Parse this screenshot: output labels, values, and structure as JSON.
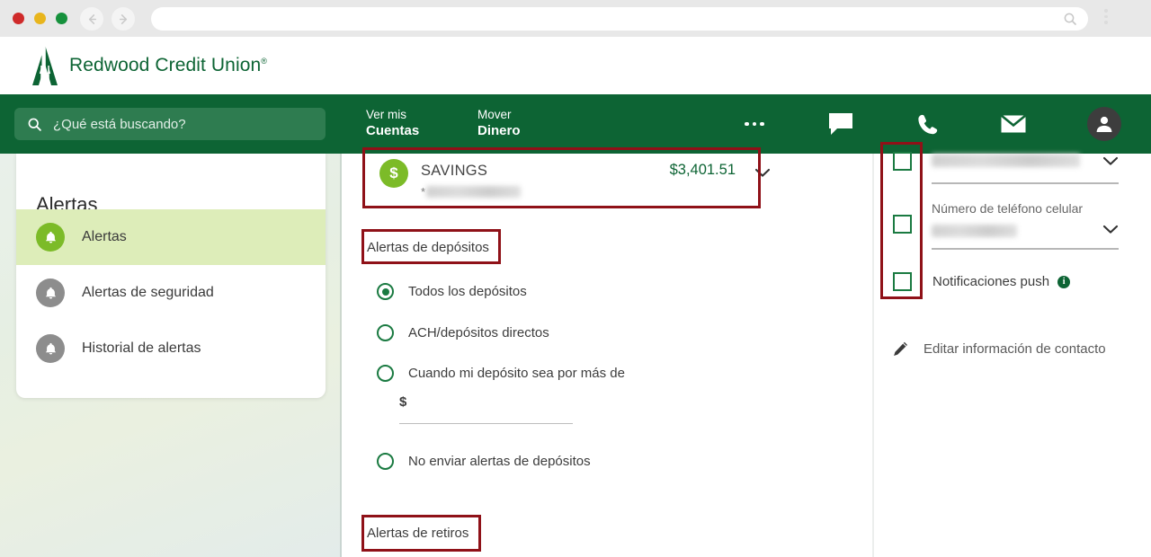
{
  "browser": {
    "back_icon": "arrow-left-icon",
    "forward_icon": "arrow-right-icon",
    "url_value": "",
    "url_search_icon": "search-icon",
    "menu_icon": "kebab-menu-icon"
  },
  "brand": {
    "name": "Redwood Credit Union",
    "trademark": "®",
    "logo_icon": "redwood-tree-logo",
    "green": "#0d6434",
    "light_green": "#7cbb28"
  },
  "nav": {
    "search": {
      "placeholder": "¿Qué está buscando?",
      "value": "",
      "icon": "search-icon"
    },
    "links": [
      {
        "line1": "Ver mis",
        "line2": "Cuentas",
        "name": "nav-accounts"
      },
      {
        "line1": "Mover",
        "line2": "Dinero",
        "name": "nav-money"
      }
    ],
    "icons": [
      {
        "name": "more-icon",
        "glyph": "•••"
      },
      {
        "name": "chat-icon",
        "glyph": "💬"
      },
      {
        "name": "phone-icon",
        "glyph": "☎"
      },
      {
        "name": "mail-icon",
        "glyph": "✉"
      },
      {
        "name": "account-avatar-icon",
        "glyph": "👤"
      }
    ]
  },
  "sidebar": {
    "title": "Alertas",
    "items": [
      {
        "label": "Alertas",
        "icon": "bell-icon",
        "active": true
      },
      {
        "label": "Alertas de seguridad",
        "icon": "bell-icon",
        "active": false
      },
      {
        "label": "Historial de alertas",
        "icon": "bell-icon",
        "active": false
      }
    ]
  },
  "main": {
    "account": {
      "name": "SAVINGS",
      "balance": "$3,401.51",
      "mask_prefix": "*",
      "mask_value": "",
      "icon": "dollar-circle-icon",
      "chevron": "chevron-down-icon"
    },
    "deposits_heading": "Alertas de depósitos",
    "deposit_options": [
      {
        "label": "Todos los depósitos",
        "selected": true
      },
      {
        "label": "ACH/depósitos directos",
        "selected": false
      },
      {
        "label": "Cuando mi depósito sea por más de",
        "selected": false
      },
      {
        "label": "No enviar alertas de depósitos",
        "selected": false
      }
    ],
    "amount_field": {
      "prefix": "$",
      "value": "",
      "placeholder": ""
    },
    "withdrawals_heading": "Alertas de retiros"
  },
  "contact": {
    "channels": [
      {
        "label": "",
        "value": "",
        "masked": true,
        "checked": false,
        "chevron": "chevron-down-icon",
        "name": "email-channel"
      },
      {
        "label": "Número de teléfono celular",
        "value": "",
        "masked": true,
        "checked": false,
        "chevron": "chevron-down-icon",
        "name": "mobile-phone-channel"
      },
      {
        "label": "Notificaciones push",
        "value": "",
        "masked": false,
        "checked": false,
        "info": "info-icon",
        "name": "push-notifications-channel"
      }
    ],
    "edit_link": {
      "label": "Editar información de contacto",
      "icon": "pencil-icon"
    }
  },
  "annotations": {
    "color": "#8f1118",
    "boxes": [
      "savings-account-row",
      "deposits-heading",
      "withdrawals-heading",
      "contact-checkbox-column"
    ]
  }
}
